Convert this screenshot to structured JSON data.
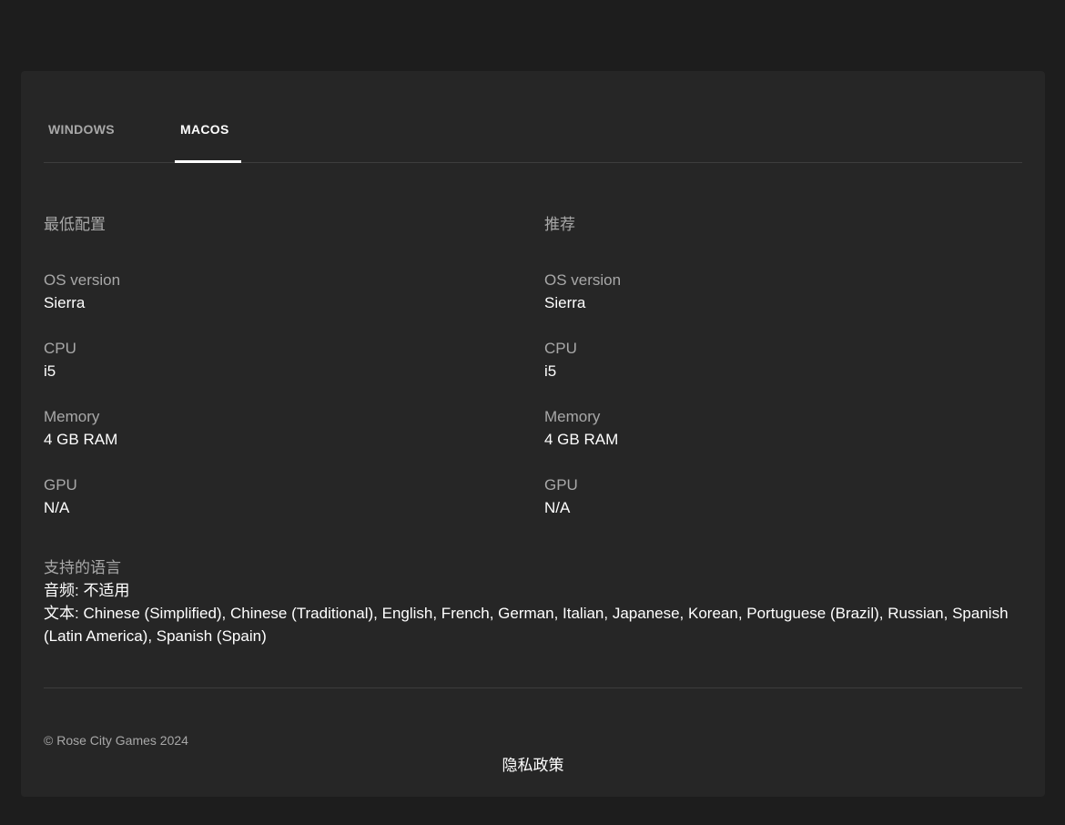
{
  "tabs": [
    "WINDOWS",
    "MACOS"
  ],
  "minimum": {
    "title": "最低配置",
    "specs": [
      {
        "label": "OS version",
        "value": "Sierra"
      },
      {
        "label": "CPU",
        "value": "i5"
      },
      {
        "label": "Memory",
        "value": "4 GB RAM"
      },
      {
        "label": "GPU",
        "value": "N/A"
      }
    ]
  },
  "recommended": {
    "title": "推荐",
    "specs": [
      {
        "label": "OS version",
        "value": "Sierra"
      },
      {
        "label": "CPU",
        "value": "i5"
      },
      {
        "label": "Memory",
        "value": "4 GB RAM"
      },
      {
        "label": "GPU",
        "value": "N/A"
      }
    ]
  },
  "languages": {
    "title": "支持的语言",
    "audio": "音频: 不适用",
    "text": "文本: Chinese (Simplified), Chinese (Traditional), English, French, German, Italian, Japanese, Korean, Portuguese (Brazil), Russian, Spanish (Latin America), Spanish (Spain)"
  },
  "footer": {
    "copyright": "© Rose City Games 2024",
    "privacy": "隐私政策"
  }
}
